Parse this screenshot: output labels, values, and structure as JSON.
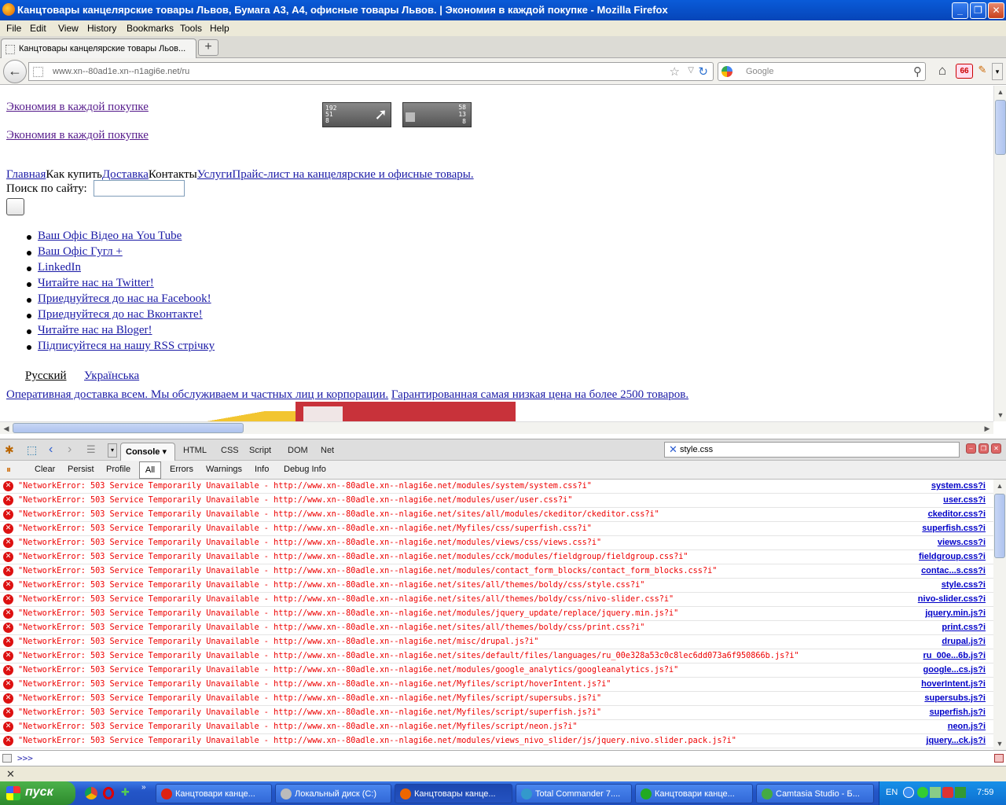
{
  "window": {
    "title": "Канцтовары канцелярские товары Львов, Бумага А3, А4, офисные товары Львов. | Экономия в каждой покупке - Mozilla Firefox",
    "minimize": "_",
    "maximize": "❐",
    "close": "✕"
  },
  "menu": [
    "File",
    "Edit",
    "View",
    "History",
    "Bookmarks",
    "Tools",
    "Help"
  ],
  "tab": {
    "title": "Канцтовары канцелярские товары Льов...",
    "new_tab": "+"
  },
  "nav": {
    "url": "www.xn--80ad1e.xn--n1agi6e.net/ru",
    "search_placeholder": "Google",
    "adblock_count": "66"
  },
  "page": {
    "slogan1": "Экономия в каждой покупке",
    "slogan2": "Экономия в каждой покупке",
    "counter1": [
      "192",
      "51",
      "8"
    ],
    "counter2": [
      "58",
      "13",
      "8"
    ],
    "menu_home": "Главная",
    "menu_howtobuy": "Как купить",
    "menu_delivery": "Доставка",
    "menu_contacts": "Контакты",
    "menu_services": "Услуги",
    "menu_price": "Прайс-лист на канцелярские и офисные товары.",
    "search_label": "Поиск по сайту:",
    "social": [
      "Ваш Офіс Відео на You Tube",
      "Ваш Офіс Гугл +",
      "LinkedIn",
      "Читайте нас на Twitter!",
      "Приеднуйтеся до нас на Facebook!",
      "Приеднуйтеся до нас Вконтакте!",
      "Читайте нас на Bloger!",
      "Підписуйтеся на нашу RSS стрічку"
    ],
    "lang_ru": "Русский",
    "lang_ua": "Українська",
    "banner_text1": "Оперативная доставка всем. Мы обслуживаем и частных лиц и корпорации.",
    "banner_text2": "Гарантированная самая низкая цена на более 2500 товаров."
  },
  "firebug": {
    "tabs": [
      "Console",
      "HTML",
      "CSS",
      "Script",
      "DOM",
      "Net"
    ],
    "search_value": "style.css",
    "sub_buttons": [
      "Clear",
      "Persist",
      "Profile",
      "All",
      "Errors",
      "Warnings",
      "Info",
      "Debug Info"
    ],
    "prompt": ">>>",
    "log": [
      {
        "msg": "\"NetworkError: 503 Service Temporarily Unavailable - http://www.xn--80adle.xn--nlagi6e.net/modules/system/system.css?i\"",
        "src": "system.css?i"
      },
      {
        "msg": "\"NetworkError: 503 Service Temporarily Unavailable - http://www.xn--80adle.xn--nlagi6e.net/modules/user/user.css?i\"",
        "src": "user.css?i"
      },
      {
        "msg": "\"NetworkError: 503 Service Temporarily Unavailable - http://www.xn--80adle.xn--nlagi6e.net/sites/all/modules/ckeditor/ckeditor.css?i\"",
        "src": "ckeditor.css?i"
      },
      {
        "msg": "\"NetworkError: 503 Service Temporarily Unavailable - http://www.xn--80adle.xn--nlagi6e.net/Myfiles/css/superfish.css?i\"",
        "src": "superfish.css?i"
      },
      {
        "msg": "\"NetworkError: 503 Service Temporarily Unavailable - http://www.xn--80adle.xn--nlagi6e.net/modules/views/css/views.css?i\"",
        "src": "views.css?i"
      },
      {
        "msg": "\"NetworkError: 503 Service Temporarily Unavailable - http://www.xn--80adle.xn--nlagi6e.net/modules/cck/modules/fieldgroup/fieldgroup.css?i\"",
        "src": "fieldgroup.css?i"
      },
      {
        "msg": "\"NetworkError: 503 Service Temporarily Unavailable - http://www.xn--80adle.xn--nlagi6e.net/modules/contact_form_blocks/contact_form_blocks.css?i\"",
        "src": "contac...s.css?i"
      },
      {
        "msg": "\"NetworkError: 503 Service Temporarily Unavailable - http://www.xn--80adle.xn--nlagi6e.net/sites/all/themes/boldy/css/style.css?i\"",
        "src": "style.css?i"
      },
      {
        "msg": "\"NetworkError: 503 Service Temporarily Unavailable - http://www.xn--80adle.xn--nlagi6e.net/sites/all/themes/boldy/css/nivo-slider.css?i\"",
        "src": "nivo-slider.css?i"
      },
      {
        "msg": "\"NetworkError: 503 Service Temporarily Unavailable - http://www.xn--80adle.xn--nlagi6e.net/modules/jquery_update/replace/jquery.min.js?i\"",
        "src": "jquery.min.js?i"
      },
      {
        "msg": "\"NetworkError: 503 Service Temporarily Unavailable - http://www.xn--80adle.xn--nlagi6e.net/sites/all/themes/boldy/css/print.css?i\"",
        "src": "print.css?i"
      },
      {
        "msg": "\"NetworkError: 503 Service Temporarily Unavailable - http://www.xn--80adle.xn--nlagi6e.net/misc/drupal.js?i\"",
        "src": "drupal.js?i"
      },
      {
        "msg": "\"NetworkError: 503 Service Temporarily Unavailable - http://www.xn--80adle.xn--nlagi6e.net/sites/default/files/languages/ru_00e328a53c0c8lec6dd073a6f950866b.js?i\"",
        "src": "ru_00e...6b.js?i"
      },
      {
        "msg": "\"NetworkError: 503 Service Temporarily Unavailable - http://www.xn--80adle.xn--nlagi6e.net/modules/google_analytics/googleanalytics.js?i\"",
        "src": "google...cs.js?i"
      },
      {
        "msg": "\"NetworkError: 503 Service Temporarily Unavailable - http://www.xn--80adle.xn--nlagi6e.net/Myfiles/script/hoverIntent.js?i\"",
        "src": "hoverIntent.js?i"
      },
      {
        "msg": "\"NetworkError: 503 Service Temporarily Unavailable - http://www.xn--80adle.xn--nlagi6e.net/Myfiles/script/supersubs.js?i\"",
        "src": "supersubs.js?i"
      },
      {
        "msg": "\"NetworkError: 503 Service Temporarily Unavailable - http://www.xn--80adle.xn--nlagi6e.net/Myfiles/script/superfish.js?i\"",
        "src": "superfish.js?i"
      },
      {
        "msg": "\"NetworkError: 503 Service Temporarily Unavailable - http://www.xn--80adle.xn--nlagi6e.net/Myfiles/script/neon.js?i\"",
        "src": "neon.js?i"
      },
      {
        "msg": "\"NetworkError: 503 Service Temporarily Unavailable - http://www.xn--80adle.xn--nlagi6e.net/modules/views_nivo_slider/js/jquery.nivo.slider.pack.js?i\"",
        "src": "jquery...ck.js?i"
      }
    ]
  },
  "taskbar": {
    "start": "пуск",
    "tasks": [
      {
        "title": "Канцтовари канце...",
        "icon_color": "#d21"
      },
      {
        "title": "Локальный диск (C:)",
        "icon_color": "#bbb"
      },
      {
        "title": "Канцтовары канце...",
        "icon_color": "#e60"
      },
      {
        "title": "Total Commander 7....",
        "icon_color": "#39c"
      },
      {
        "title": "Канцтовари канце...",
        "icon_color": "#2a2"
      },
      {
        "title": "Camtasia Studio - Б...",
        "icon_color": "#4a4"
      }
    ],
    "lang": "EN",
    "time": "7:59"
  }
}
